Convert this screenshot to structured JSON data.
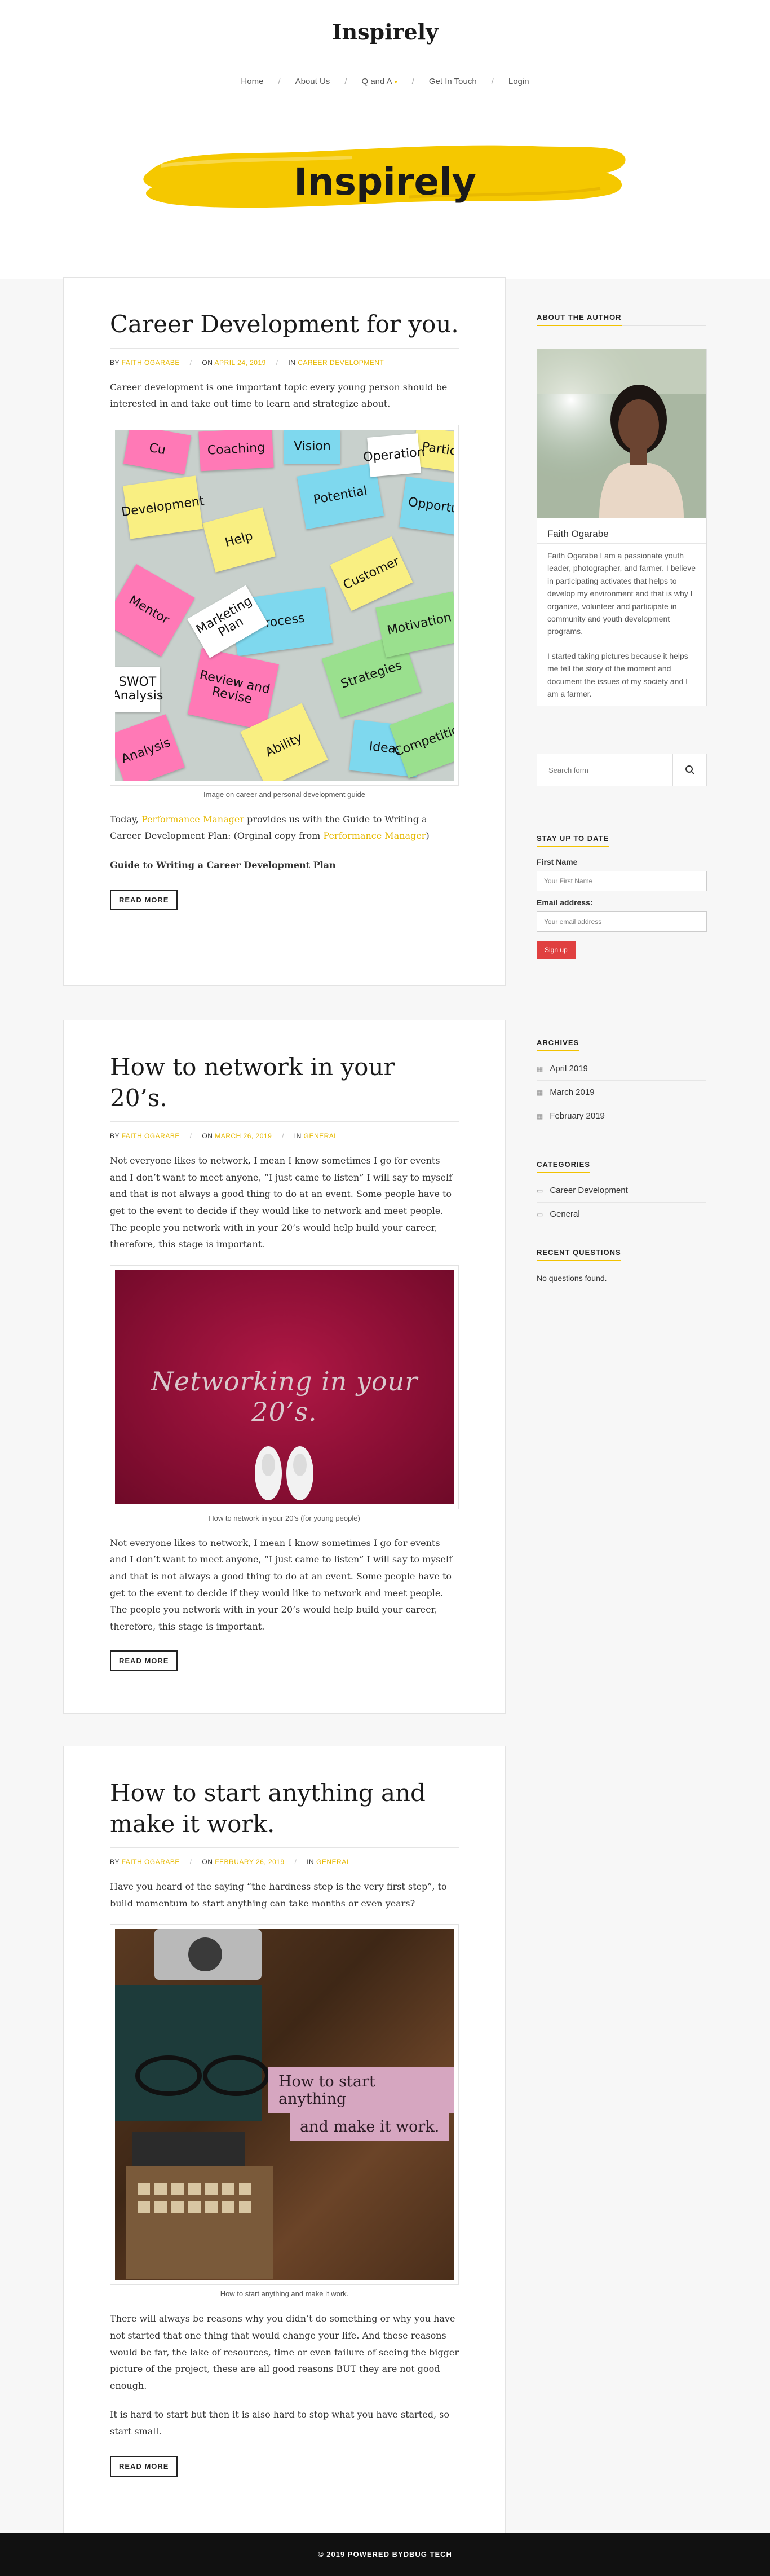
{
  "site": {
    "title": "Inspirely",
    "banner_title": "Inspirely"
  },
  "nav": {
    "items": [
      {
        "label": "Home"
      },
      {
        "label": "About Us"
      },
      {
        "label": "Q and A"
      },
      {
        "label": "Get In Touch"
      },
      {
        "label": "Login"
      }
    ],
    "separator": "/"
  },
  "posts": [
    {
      "title": "Career Development for you.",
      "meta": {
        "by": "BY",
        "author": "FAITH OGARABE",
        "on": "ON",
        "date": "APRIL 24, 2019",
        "in": "IN",
        "category": "CAREER DEVELOPMENT"
      },
      "p1": "Career development is one important topic every young person should be interested in and take out time to learn and strategize about.",
      "caption": "Image on career and personal development guide",
      "p2_a": "Today, ",
      "p2_link": "Performance Manager",
      "p2_b": " provides us with the Guide to Writing a Career Development Plan: (Orginal copy from ",
      "p2_link2": "Performance Manager",
      "p2_c": ")",
      "p3": "Guide to Writing a Career Development Plan",
      "read_more": "READ MORE",
      "notes": [
        "Coaching",
        "Help",
        "Potential",
        "Customer",
        "Process",
        "Review and Revise",
        "Strategies",
        "Ability",
        "Development",
        "Mentor",
        "Vision",
        "Motivation",
        "Ideas",
        "Analysis",
        "SWOT Analysis",
        "Opportu",
        "Marketing Plan",
        "Competition",
        "Partic",
        "Cu",
        "Operation"
      ]
    },
    {
      "title": "How to network in your 20’s.",
      "meta": {
        "by": "BY",
        "author": "FAITH OGARABE",
        "on": "ON",
        "date": "MARCH 26, 2019",
        "in": "IN",
        "category": "GENERAL"
      },
      "p1": "Not everyone likes to network,  I mean I know sometimes I go for events and I don’t want to meet anyone, “I just came to listen” I will say to myself and that is not always a good thing to do at an event. Some people have to get to the event to decide if they would like to network and meet people. The people you network with in your 20’s would help build your career, therefore, this stage is important.",
      "image_text": "Networking in your 20’s.",
      "caption": "How to network in your 20’s (for young people)",
      "p2": "Not everyone likes to network,  I mean I know sometimes I go for events and I don’t want to meet anyone, “I just came to listen” I will say to myself and that is not always a good thing to do at an event. Some people have to get to the event to decide if they would like to network and meet people. The people you network with in your 20’s would help build your career, therefore, this stage is important.",
      "read_more": "READ MORE"
    },
    {
      "title": "How to start anything and make it work.",
      "meta": {
        "by": "BY",
        "author": "FAITH OGARABE",
        "on": "ON",
        "date": "FEBRUARY 26, 2019",
        "in": "IN",
        "category": "GENERAL"
      },
      "p1": "Have you heard of the saying “the hardness step is the very first step”, to build momentum to start anything can take months or even years?",
      "image_text_1": "How to start anything",
      "image_text_2": "and make it work.",
      "caption": "How to start anything and make it work.",
      "p2": "There will always be reasons why you didn’t do something or why you have not started that one thing that would change your life. And these reasons would be far, the lake of resources, time or even failure of seeing the bigger picture of the project, these are all good reasons BUT they are not good enough.",
      "p3": "It is hard to start but then it is also hard to stop what you have started, so start small.",
      "read_more": "READ MORE"
    }
  ],
  "sidebar": {
    "author": {
      "title": "ABOUT THE AUTHOR",
      "name": "Faith Ogarabe",
      "bio1": "Faith Ogarabe I am a passionate youth leader, photographer, and farmer. I believe in participating activates that helps to develop my environment and that is why I organize, volunteer and participate in community and youth development programs.",
      "bio2": "I started taking pictures because it helps me tell the story of the moment and document the issues of my society and I am a farmer."
    },
    "search": {
      "placeholder": "Search form"
    },
    "subscribe": {
      "title": "STAY UP TO DATE",
      "first_name_label": "First Name",
      "first_name_placeholder": "Your First Name",
      "email_label": "Email address:",
      "email_placeholder": "Your email address",
      "button": "Sign up"
    },
    "archives": {
      "title": "ARCHIVES",
      "items": [
        "April 2019",
        "March 2019",
        "February 2019"
      ]
    },
    "categories": {
      "title": "CATEGORIES",
      "items": [
        "Career Development",
        "General"
      ]
    },
    "recent_questions": {
      "title": "RECENT QUESTIONS",
      "empty": "No questions found."
    }
  },
  "footer": {
    "text": "© 2019 POWERED BYDBUG TECH"
  },
  "colors": {
    "accent": "#f2c200",
    "footer": "#111111",
    "signup": "#e04040"
  }
}
